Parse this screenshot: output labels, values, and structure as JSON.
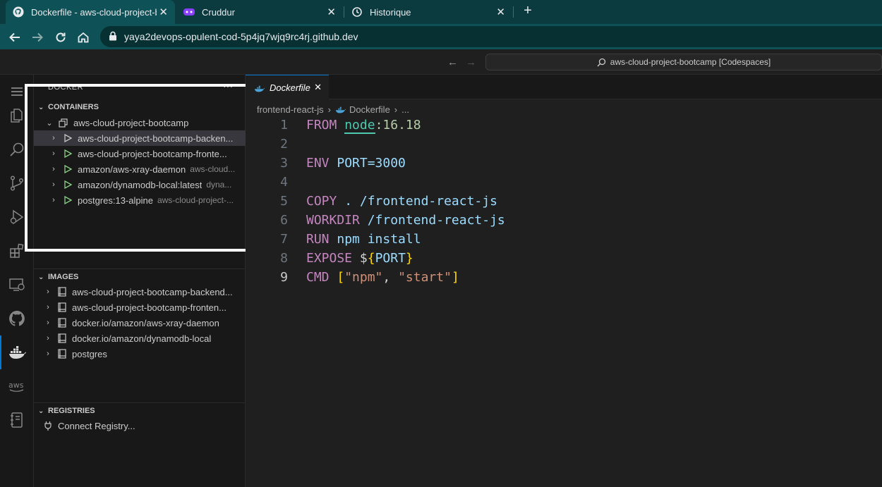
{
  "browser": {
    "tabs": [
      {
        "title": "Dockerfile - aws-cloud-project-bootcamp",
        "active": true
      },
      {
        "title": "Cruddur",
        "active": false
      },
      {
        "title": "Historique",
        "active": false
      }
    ],
    "url": "yaya2devops-opulent-cod-5p4jq7wjq9rc4rj.github.dev"
  },
  "vscode": {
    "command_center": "aws-cloud-project-bootcamp [Codespaces]"
  },
  "sidebar": {
    "title": "DOCKER",
    "containers": {
      "header": "CONTAINERS",
      "group": "aws-cloud-project-bootcamp",
      "items": [
        {
          "label": "aws-cloud-project-bootcamp-backen...",
          "desc": "",
          "running": false
        },
        {
          "label": "aws-cloud-project-bootcamp-fronte...",
          "desc": "",
          "running": true
        },
        {
          "label": "amazon/aws-xray-daemon",
          "desc": "aws-cloud...",
          "running": true
        },
        {
          "label": "amazon/dynamodb-local:latest",
          "desc": "dyna...",
          "running": true
        },
        {
          "label": "postgres:13-alpine",
          "desc": "aws-cloud-project-...",
          "running": true
        }
      ]
    },
    "images": {
      "header": "IMAGES",
      "items": [
        "aws-cloud-project-bootcamp-backend...",
        "aws-cloud-project-bootcamp-fronten...",
        "docker.io/amazon/aws-xray-daemon",
        "docker.io/amazon/dynamodb-local",
        "postgres"
      ]
    },
    "registries": {
      "header": "REGISTRIES",
      "connect": "Connect Registry..."
    }
  },
  "editor": {
    "tab_label": "Dockerfile",
    "breadcrumb": [
      "frontend-react-js",
      "Dockerfile",
      "..."
    ],
    "line_numbers": [
      "1",
      "2",
      "3",
      "4",
      "5",
      "6",
      "7",
      "8",
      "9"
    ],
    "code": {
      "l1": {
        "kw": "FROM",
        "image": "node",
        "tag": ":16.18"
      },
      "l3": {
        "kw": "ENV",
        "rest": "PORT=3000"
      },
      "l5": {
        "kw": "COPY",
        "rest": ". /frontend-react-js"
      },
      "l6": {
        "kw": "WORKDIR",
        "rest": "/frontend-react-js"
      },
      "l7": {
        "kw": "RUN",
        "rest": "npm install"
      },
      "l8": {
        "kw": "EXPOSE",
        "dollar": "$",
        "open": "{",
        "var": "PORT",
        "close": "}"
      },
      "l9": {
        "kw": "CMD",
        "open": "[",
        "s1": "\"npm\"",
        "comma": ", ",
        "s2": "\"start\"",
        "close": "]"
      }
    }
  }
}
